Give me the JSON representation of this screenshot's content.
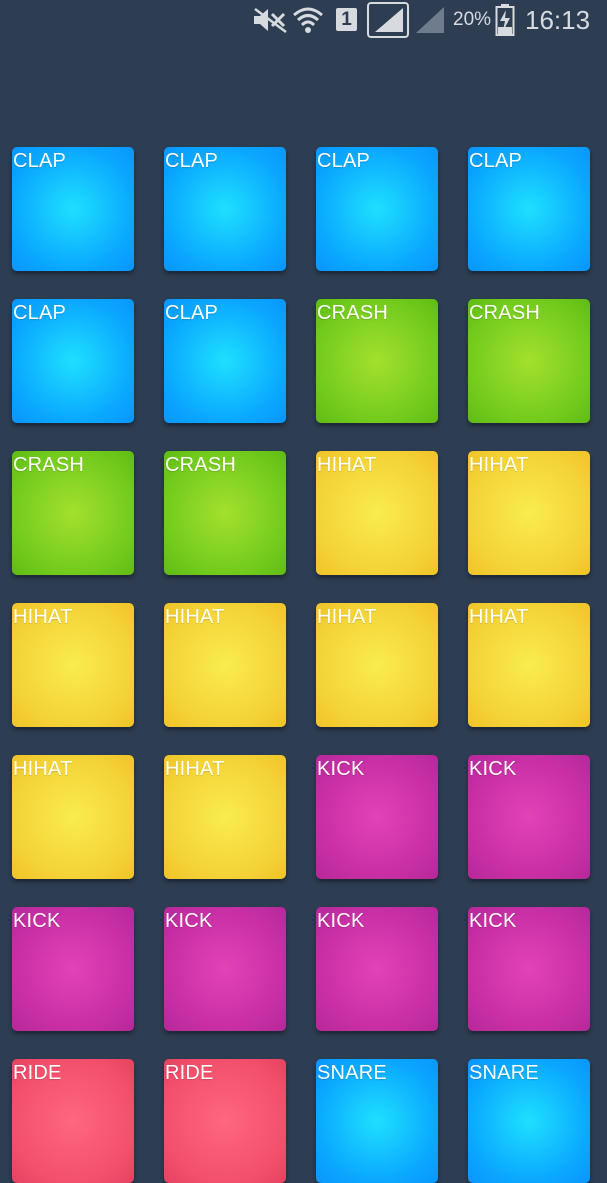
{
  "status_bar": {
    "battery_percent": "20%",
    "time": "16:13",
    "sim_slot": "1",
    "icons": [
      "mute-icon",
      "wifi-icon",
      "sim-icon",
      "signal-icon",
      "signal-icon",
      "battery-charging-icon"
    ]
  },
  "colors": {
    "background": "#2d3d52",
    "clap": "#0aa7ff",
    "crash": "#72cb1c",
    "hihat": "#f4d236",
    "kick": "#c72ea4",
    "ride": "#f2506b",
    "snare": "#0aa7ff"
  },
  "pads": [
    {
      "label": "CLAP"
    },
    {
      "label": "CLAP"
    },
    {
      "label": "CLAP"
    },
    {
      "label": "CLAP"
    },
    {
      "label": "CLAP"
    },
    {
      "label": "CLAP"
    },
    {
      "label": "CRASH"
    },
    {
      "label": "CRASH"
    },
    {
      "label": "CRASH"
    },
    {
      "label": "CRASH"
    },
    {
      "label": "HIHAT"
    },
    {
      "label": "HIHAT"
    },
    {
      "label": "HIHAT"
    },
    {
      "label": "HIHAT"
    },
    {
      "label": "HIHAT"
    },
    {
      "label": "HIHAT"
    },
    {
      "label": "HIHAT"
    },
    {
      "label": "HIHAT"
    },
    {
      "label": "KICK"
    },
    {
      "label": "KICK"
    },
    {
      "label": "KICK"
    },
    {
      "label": "KICK"
    },
    {
      "label": "KICK"
    },
    {
      "label": "KICK"
    },
    {
      "label": "RIDE"
    },
    {
      "label": "RIDE"
    },
    {
      "label": "SNARE"
    },
    {
      "label": "SNARE"
    }
  ]
}
